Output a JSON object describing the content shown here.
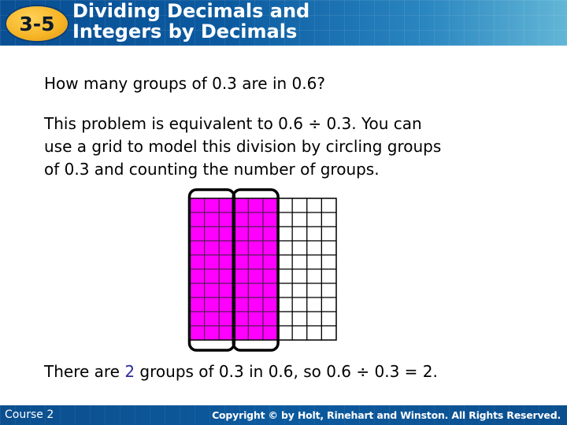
{
  "header": {
    "lesson_number": "3-5",
    "title_line1": "Dividing Decimals and",
    "title_line2": "Integers by Decimals"
  },
  "content": {
    "question": "How many groups of 0.3 are in 0.6?",
    "explanation_lines": [
      "This problem is equivalent to 0.6 ÷ 0.3. You can",
      "use a grid to model this division by circling groups",
      "of 0.3 and counting the number of groups."
    ],
    "answer_prefix": "There are ",
    "answer_highlight": "2",
    "answer_suffix": " groups of 0.3 in 0.6, so 0.6 ÷ 0.3 = 2."
  },
  "grid_model": {
    "columns": 10,
    "rows": 10,
    "shaded_columns": 6,
    "group_size_columns": 3,
    "groups_circled": 2,
    "shade_color": "#ff00ff",
    "line_color": "#000000",
    "outline_color": "#000000"
  },
  "footer": {
    "course": "Course 2",
    "copyright": "Copyright © by Holt, Rinehart and Winston. All Rights Reserved."
  },
  "colors": {
    "header_blue": "#0b5aa0",
    "badge_yellow": "#f5b324",
    "answer_highlight": "#2b2b9a"
  }
}
